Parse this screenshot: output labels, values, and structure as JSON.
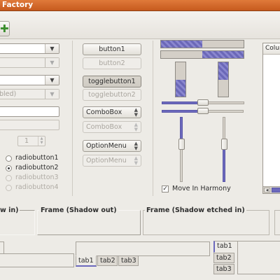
{
  "window": {
    "title": "Factory"
  },
  "toolbar": {
    "add_icon": "plus-icon",
    "add_glyph": "✚",
    "add_color": "#3b8e2e"
  },
  "entries": {
    "disabled_combo_entry_text": "bled)"
  },
  "spin": {
    "value": "1"
  },
  "radios": [
    {
      "label": "radiobutton1",
      "checked": false,
      "enabled": true
    },
    {
      "label": "radiobutton2",
      "checked": true,
      "enabled": true
    },
    {
      "label": "radiobutton3",
      "checked": false,
      "enabled": false
    },
    {
      "label": "radiobutton4",
      "checked": false,
      "enabled": false
    }
  ],
  "buttons": {
    "button1": "button1",
    "button2": "button2",
    "togglebutton1": "togglebutton1",
    "togglebutton2": "togglebutton2",
    "combobox1": "ComboBox",
    "combobox2": "ComboBox",
    "optionmenu1": "OptionMenu",
    "optionmenu2": "OptionMenu"
  },
  "progress": {
    "h1": 0.5,
    "h2": 0.5,
    "v1": 0.5,
    "v2": 0.5
  },
  "scales": {
    "h1": 0.5,
    "h2": 0.5,
    "v1": 0.4,
    "v2": 0.4
  },
  "checkbox": {
    "label": "Move In Harmony",
    "checked": true,
    "mark": "✓"
  },
  "treeview": {
    "column_header": "Column",
    "scroll_left_glyph": "◀"
  },
  "frames": [
    {
      "label": "Frame (Shadow in)",
      "visible_label": "w in)"
    },
    {
      "label": "Frame (Shadow out)"
    },
    {
      "label": "Frame (Shadow etched in)"
    }
  ],
  "notebook_bottom": {
    "tabs": [
      "tab1",
      "tab2",
      "tab3"
    ]
  },
  "notebook_left": {
    "tabs": [
      "tab1",
      "tab2",
      "tab3"
    ]
  },
  "colors": {
    "accent": "#6c69bd",
    "titlebar": "#d0652a",
    "background": "#edebe6"
  }
}
